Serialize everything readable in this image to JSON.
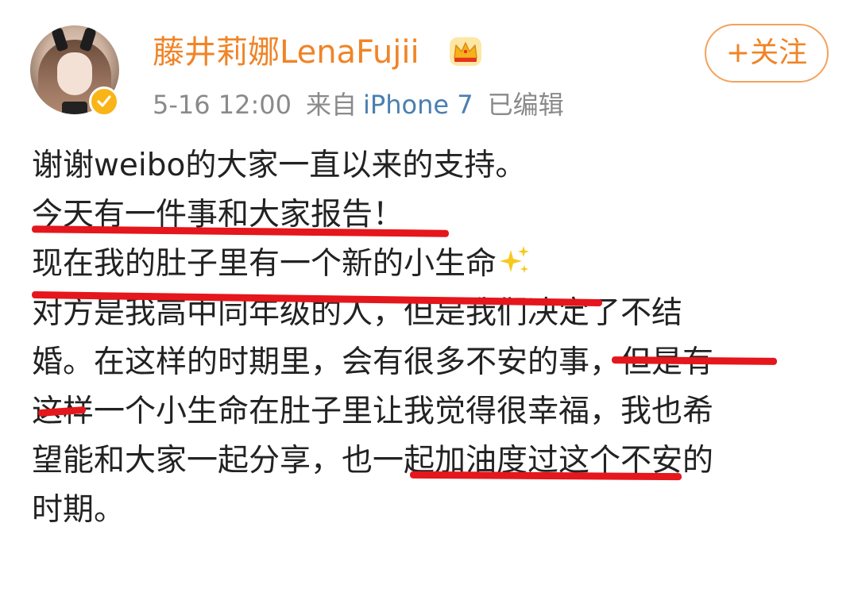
{
  "post": {
    "username": "藤井莉娜LenaFujii",
    "follow_label": "+关注",
    "time": "5-16 12:00",
    "source_prefix": "来自",
    "source_device": "iPhone 7",
    "edited": "已编辑",
    "lines": [
      "谢谢weibo的大家一直以来的支持。",
      "今天有一件事和大家报告！",
      "现在我的肚子里有一个新的小生命",
      "对方是我高中同年级的人，但是我们决定了不结",
      "婚。在这样的时期里，会有很多不安的事，但是有",
      "这样一个小生命在肚子里让我觉得很幸福，我也希",
      "望能和大家一起分享，也一起加油度过这个不安的",
      "时期。"
    ]
  },
  "icons": {
    "avatar": "avatar-photo",
    "badge": "verified-badge-icon",
    "crown": "crown-icon",
    "sparkle": "sparkles-icon"
  },
  "colors": {
    "username": "#f08427",
    "source_link": "#4a7fb0",
    "meta": "#8a8a8a",
    "body_text": "#222222",
    "underline": "#e5161c",
    "badge": "#f9b417"
  }
}
